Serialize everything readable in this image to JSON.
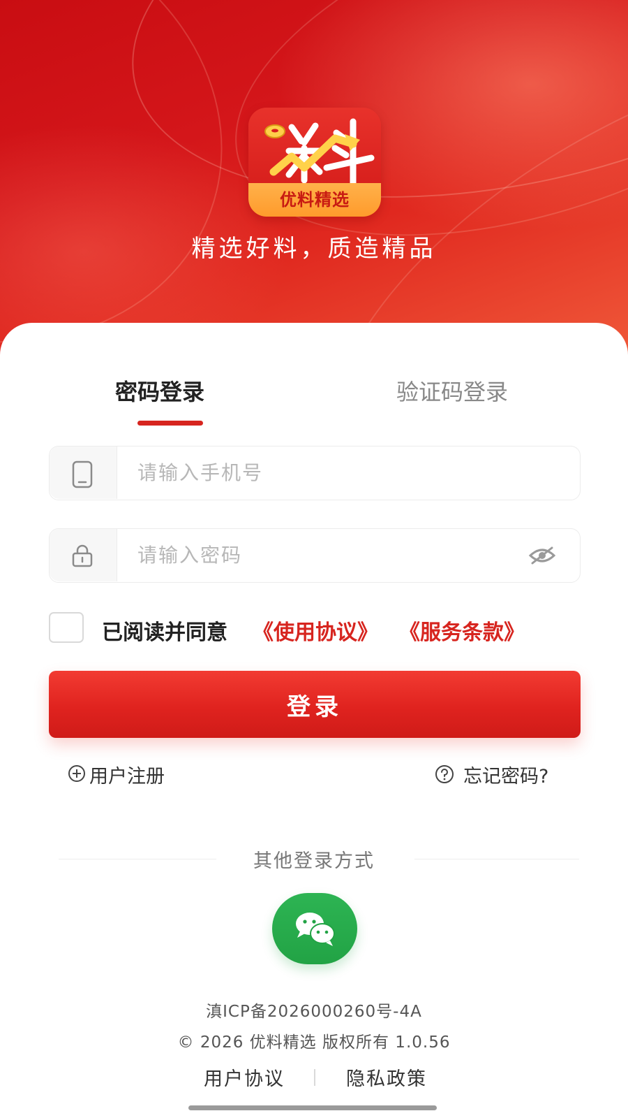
{
  "hero": {
    "logo_text": "优料精选",
    "logo_glyph": "料",
    "slogan": "精选好料，质造精品",
    "logo_icon": "app-logo-icon"
  },
  "tabs": [
    {
      "label": "密码登录",
      "active": true
    },
    {
      "label": "验证码登录",
      "active": false
    }
  ],
  "form": {
    "phone": {
      "placeholder": "请输入手机号",
      "icon": "phone-icon"
    },
    "password": {
      "placeholder": "请输入密码",
      "icon": "lock-icon",
      "toggle_icon": "eye-hidden-icon"
    }
  },
  "agreement": {
    "prefix": "已阅读并同意",
    "terms_link": "《使用协议》",
    "service_link": "《服务条款》",
    "checked": false
  },
  "login_button": "登录",
  "links": {
    "register": "用户注册",
    "forgot": "忘记密码?"
  },
  "other_login": {
    "label": "其他登录方式",
    "wechat_icon": "wechat-icon"
  },
  "footer": {
    "icp": "滇ICP备2026000260号-4A",
    "copyright": "© 2026 优料精选 版权所有 1.0.56",
    "agreement_link": "用户协议",
    "privacy_link": "隐私政策"
  },
  "colors": {
    "brand_red": "#d7251f",
    "wechat_green": "#22a345",
    "logo_band": "#ff9b2c"
  }
}
